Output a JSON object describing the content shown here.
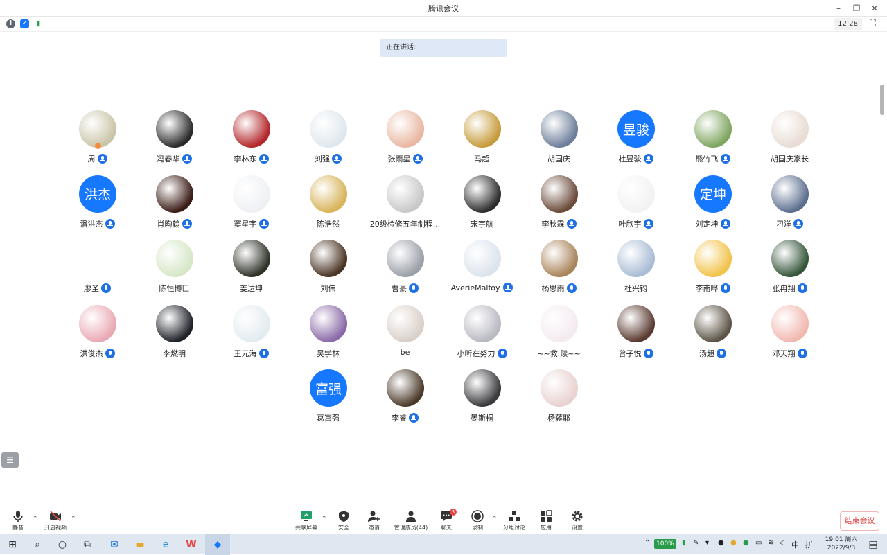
{
  "window": {
    "title": "腾讯会议"
  },
  "status": {
    "clock": "12:28"
  },
  "speaking": {
    "label": "正在讲话:"
  },
  "participants": [
    {
      "name": "周",
      "avatar": "photo",
      "color": "#c9c5a8",
      "mic": true,
      "host": true
    },
    {
      "name": "冯春华",
      "avatar": "photo",
      "color": "#2b2b2b",
      "mic": true
    },
    {
      "name": "李林东",
      "avatar": "photo",
      "color": "#b3262a",
      "mic": true
    },
    {
      "name": "刘强",
      "avatar": "photo",
      "color": "#dfe7ee",
      "mic": true
    },
    {
      "name": "张雨星",
      "avatar": "photo",
      "color": "#e9b7a1",
      "mic": true
    },
    {
      "name": "马超",
      "avatar": "photo",
      "color": "#c69b3b",
      "mic": false
    },
    {
      "name": "胡国庆",
      "avatar": "photo",
      "color": "#6d7e9a",
      "mic": false
    },
    {
      "name": "杜昱骏",
      "avatar": "text",
      "text": "昱骏",
      "mic": true
    },
    {
      "name": "熊竹飞",
      "avatar": "photo",
      "color": "#7ea560",
      "mic": true
    },
    {
      "name": "胡国庆家长",
      "avatar": "photo",
      "color": "#e8dcd4",
      "mic": false
    },
    {
      "name": "潘洪杰",
      "avatar": "text",
      "text": "洪杰",
      "mic": true
    },
    {
      "name": "肖昀翰",
      "avatar": "photo",
      "color": "#3a1b16",
      "mic": true
    },
    {
      "name": "窦星宇",
      "avatar": "photo",
      "color": "#eef0f4",
      "mic": true
    },
    {
      "name": "陈浩然",
      "avatar": "photo",
      "color": "#d8b45a",
      "mic": false
    },
    {
      "name": "20级检修五年制程...",
      "avatar": "photo",
      "color": "#c8c8c8",
      "mic": false
    },
    {
      "name": "宋宇航",
      "avatar": "photo",
      "color": "#2d2d2d",
      "mic": false
    },
    {
      "name": "李秋霖",
      "avatar": "photo",
      "color": "#6b4a3a",
      "mic": true
    },
    {
      "name": "叶欣宇",
      "avatar": "photo",
      "color": "#f2f2f2",
      "mic": true
    },
    {
      "name": "刘定坤",
      "avatar": "text",
      "text": "定坤",
      "mic": true
    },
    {
      "name": "刁洋",
      "avatar": "photo",
      "color": "#5d6f8f",
      "mic": true
    },
    {
      "name": "廖圣",
      "avatar": "none",
      "mic": true
    },
    {
      "name": "陈恒博匚",
      "avatar": "photo",
      "color": "#d6e7c6",
      "mic": false
    },
    {
      "name": "姜达坤",
      "avatar": "photo",
      "color": "#2e3228",
      "mic": false
    },
    {
      "name": "刘伟",
      "avatar": "photo",
      "color": "#4a3424",
      "mic": false
    },
    {
      "name": "曹豪",
      "avatar": "photo",
      "color": "#9aa0a8",
      "mic": true
    },
    {
      "name": "AverieMalfoy.",
      "avatar": "photo",
      "color": "#dbe3ec",
      "mic": true
    },
    {
      "name": "杨思雨",
      "avatar": "photo",
      "color": "#a9845a",
      "mic": true
    },
    {
      "name": "杜兴钧",
      "avatar": "photo",
      "color": "#a9bcd6",
      "mic": false
    },
    {
      "name": "李南晔",
      "avatar": "photo",
      "color": "#f2c34a",
      "mic": true
    },
    {
      "name": "张冉翔",
      "avatar": "photo",
      "color": "#35563a",
      "mic": true
    },
    {
      "name": "洪俊杰",
      "avatar": "photo",
      "color": "#e9a9b4",
      "mic": true
    },
    {
      "name": "李燃明",
      "avatar": "photo",
      "color": "#1e2128",
      "mic": false
    },
    {
      "name": "王元海",
      "avatar": "photo",
      "color": "#e3ecef",
      "mic": true
    },
    {
      "name": "吴学林",
      "avatar": "photo",
      "color": "#8a6aa8",
      "mic": false
    },
    {
      "name": "be",
      "avatar": "photo",
      "color": "#d9cfc9",
      "mic": false
    },
    {
      "name": "小昕在努力",
      "avatar": "photo",
      "color": "#b9b9c2",
      "mic": true
    },
    {
      "name": "~~救.赎~~",
      "avatar": "photo",
      "color": "#f4eaf0",
      "mic": false
    },
    {
      "name": "曾子悦",
      "avatar": "photo",
      "color": "#5a3a30",
      "mic": true
    },
    {
      "name": "汤超",
      "avatar": "photo",
      "color": "#5c5446",
      "mic": true
    },
    {
      "name": "邓天翔",
      "avatar": "photo",
      "color": "#f2b8b0",
      "mic": true
    },
    {
      "name": "",
      "avatar": "none",
      "mic": false,
      "spacer": true
    },
    {
      "name": "",
      "avatar": "none",
      "mic": false,
      "spacer": true
    },
    {
      "name": "",
      "avatar": "none",
      "mic": false,
      "spacer": true
    },
    {
      "name": "葛富强",
      "avatar": "text",
      "text": "富强",
      "mic": false
    },
    {
      "name": "李睿",
      "avatar": "photo",
      "color": "#4a3a2a",
      "mic": true
    },
    {
      "name": "晏斯桐",
      "avatar": "photo",
      "color": "#3a3a3e",
      "mic": false
    },
    {
      "name": "杨蕤耶",
      "avatar": "photo",
      "color": "#e8d2d0",
      "mic": false
    }
  ],
  "toolbar": {
    "mute": "静音",
    "video": "开启视频",
    "share": "共享屏幕",
    "security": "安全",
    "invite": "邀请",
    "members": "管理成员(44)",
    "chat": "聊天",
    "chat_badge": "3",
    "record": "录制",
    "breakout": "分组讨论",
    "apps": "应用",
    "settings": "设置",
    "end": "结束会议"
  },
  "taskbar": {
    "battery": "100%",
    "ime": "中",
    "ime2": "拼",
    "time": "19:01 周六",
    "date": "2022/9/3"
  },
  "colors": {
    "accent": "#1677ff",
    "end": "#e54545"
  }
}
